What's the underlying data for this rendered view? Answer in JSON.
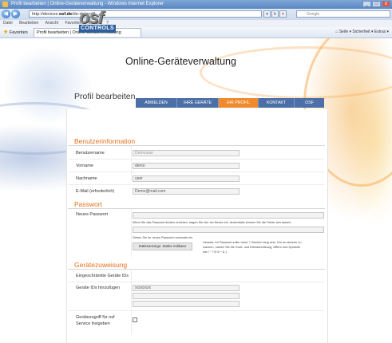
{
  "window": {
    "title": "Profil bearbeiten | Online-Geräteverwaltung - Windows Internet Explorer",
    "controls": [
      "_",
      "□",
      "x"
    ]
  },
  "address_bar": {
    "url_prefix": "http://devices.",
    "url_domain": "osf.de",
    "url_suffix": "/de-de/profil",
    "search_placeholder": "Google"
  },
  "menu": [
    "Datei",
    "Bearbeiten",
    "Ansicht",
    "Favoriten",
    "Extras",
    "?"
  ],
  "favorites": {
    "label": "Favoriten",
    "tab_title": "Profil bearbeiten | Online-Geräteverwaltung",
    "tools": "Seite ▾   Sicherheit ▾   Extras ▾"
  },
  "header": {
    "logo_text": "osf",
    "logo_sub": "CONTROLS",
    "app_title": "Online-Geräteverwaltung"
  },
  "nav": [
    {
      "label": "ABMELDEN",
      "active": false
    },
    {
      "label": "IHRE GERÄTE",
      "active": false
    },
    {
      "label": "IHR PROFIL",
      "active": true
    },
    {
      "label": "KONTAKT",
      "active": false
    },
    {
      "label": "OSF",
      "active": false
    }
  ],
  "page_title": "Profil bearbeiten",
  "benutzer": {
    "section_title": "Benutzerinformation",
    "username_label": "Benutzername",
    "username_value": "Demouser",
    "firstname_label": "Vorname",
    "firstname_value": "demo",
    "lastname_label": "Nachname",
    "lastname_value": "user",
    "email_label": "E-Mail (erforderlich)",
    "email_value": "Demo@mail.com"
  },
  "passwort": {
    "section_title": "Passwort",
    "new_label": "Neues Passwort",
    "hint1": "Wenn Sie das Passwort ändern möchten, tragen Sie hier ein Neues ein. Andernfalls können Sie die Felder leer lassen.",
    "hint2": "Geben Sie Ihr neues Passwort nochmals ein.",
    "strength_button": "Stärkeanzeige: Stärke indikator",
    "strength_note_1": "Hinweis: Ihr Passwort sollte mind. 7 Zeichen lang sein. Um es sicherer zu",
    "strength_note_2": "machen, nutzen Sie die Groß- und Kleinschreibung, Ziffern und Symbole",
    "strength_note_3": "wie ! \" ? $ % ^ & )."
  },
  "geraete": {
    "section_title": "Gerätezuweisung",
    "assigned_label": "Eingeschränkte Geräte IDs",
    "add_label": "Geräte IDs hinzufügen",
    "add_value": "xxxxxxxx",
    "access_label_1": "Gerätezugriff für osf",
    "access_label_2": "Service freigeben"
  }
}
